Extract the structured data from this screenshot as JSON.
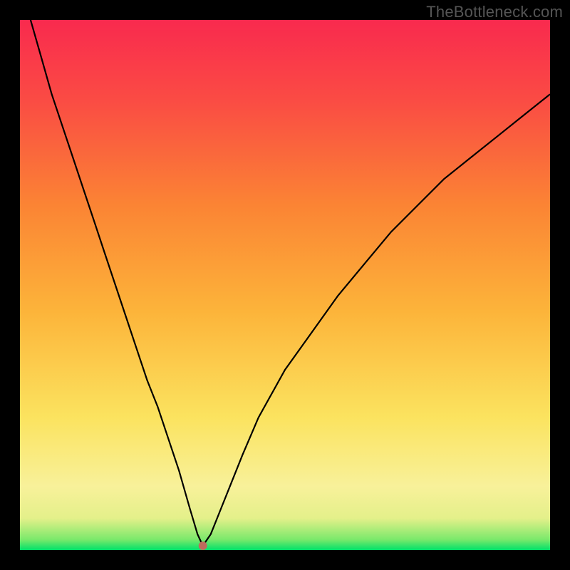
{
  "watermark": "TheBottleneck.com",
  "chart_data": {
    "type": "line",
    "title": "",
    "xlabel": "",
    "ylabel": "",
    "xlim": [
      0,
      100
    ],
    "ylim": [
      0,
      100
    ],
    "gradient_stops": [
      {
        "offset": 0.0,
        "color": "#00e169"
      },
      {
        "offset": 0.02,
        "color": "#7be96b"
      },
      {
        "offset": 0.06,
        "color": "#e4f08a"
      },
      {
        "offset": 0.12,
        "color": "#f8f19a"
      },
      {
        "offset": 0.25,
        "color": "#fbe35f"
      },
      {
        "offset": 0.45,
        "color": "#fcb43a"
      },
      {
        "offset": 0.65,
        "color": "#fb8434"
      },
      {
        "offset": 0.85,
        "color": "#fa4b44"
      },
      {
        "offset": 1.0,
        "color": "#f92a4e"
      }
    ],
    "series": [
      {
        "name": "bottleneck-curve",
        "x": [
          2,
          4,
          6,
          8,
          10,
          12,
          14,
          16,
          18,
          20,
          22,
          24,
          26,
          28,
          30,
          32,
          33.5,
          34.5,
          36,
          38,
          40,
          42,
          45,
          50,
          55,
          60,
          65,
          70,
          75,
          80,
          85,
          90,
          95,
          100
        ],
        "y": [
          100,
          93,
          86,
          80,
          74,
          68,
          62,
          56,
          50,
          44,
          38,
          32,
          27,
          21,
          15,
          8,
          3,
          0.8,
          3,
          8,
          13,
          18,
          25,
          34,
          41,
          48,
          54,
          60,
          65,
          70,
          74,
          78,
          82,
          86
        ]
      }
    ],
    "marker": {
      "x": 34.5,
      "y": 0.8,
      "color": "#bf6b5d",
      "radius_px": 6
    },
    "curve_color": "#000000"
  }
}
